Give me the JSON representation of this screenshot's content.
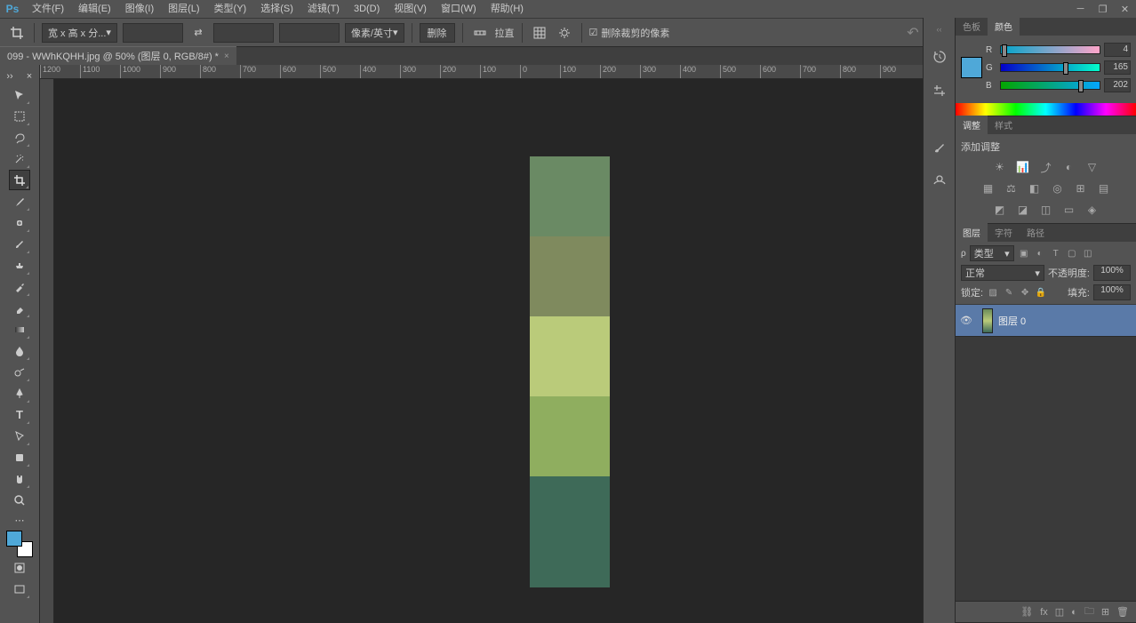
{
  "app": {
    "logo": "Ps"
  },
  "menu": [
    "文件(F)",
    "编辑(E)",
    "图像(I)",
    "图层(L)",
    "类型(Y)",
    "选择(S)",
    "滤镜(T)",
    "3D(D)",
    "视图(V)",
    "窗口(W)",
    "帮助(H)"
  ],
  "options": {
    "preset": "宽 x 高 x 分...",
    "unit": "像素/英寸",
    "delete_btn": "删除",
    "straighten": "拉直",
    "delete_cropped": "删除裁剪的像素"
  },
  "document": {
    "tab_title": "099 - WWhKQHH.jpg @ 50% (图层 0, RGB/8#) *"
  },
  "ruler_marks": [
    "1200",
    "1100",
    "1000",
    "900",
    "800",
    "700",
    "600",
    "500",
    "400",
    "300",
    "200",
    "100",
    "0",
    "100",
    "200",
    "300",
    "400",
    "500",
    "600",
    "700",
    "800",
    "900"
  ],
  "canvas_colors": [
    "#6a8a64",
    "#7f8a5e",
    "#bacb7a",
    "#8fae5f",
    "#3e6a58"
  ],
  "color_panel": {
    "tabs": [
      "色板",
      "颜色"
    ],
    "r_label": "R",
    "g_label": "G",
    "b_label": "B",
    "r": "4",
    "g": "165",
    "b": "202"
  },
  "adjustments_panel": {
    "tabs": [
      "调整",
      "样式"
    ],
    "title": "添加调整"
  },
  "layers_panel": {
    "tabs": [
      "图层",
      "字符",
      "路径"
    ],
    "kind": "类型",
    "blend": "正常",
    "opacity_label": "不透明度:",
    "opacity": "100%",
    "lock_label": "锁定:",
    "fill_label": "填充:",
    "fill": "100%",
    "layer_name": "图层 0"
  }
}
